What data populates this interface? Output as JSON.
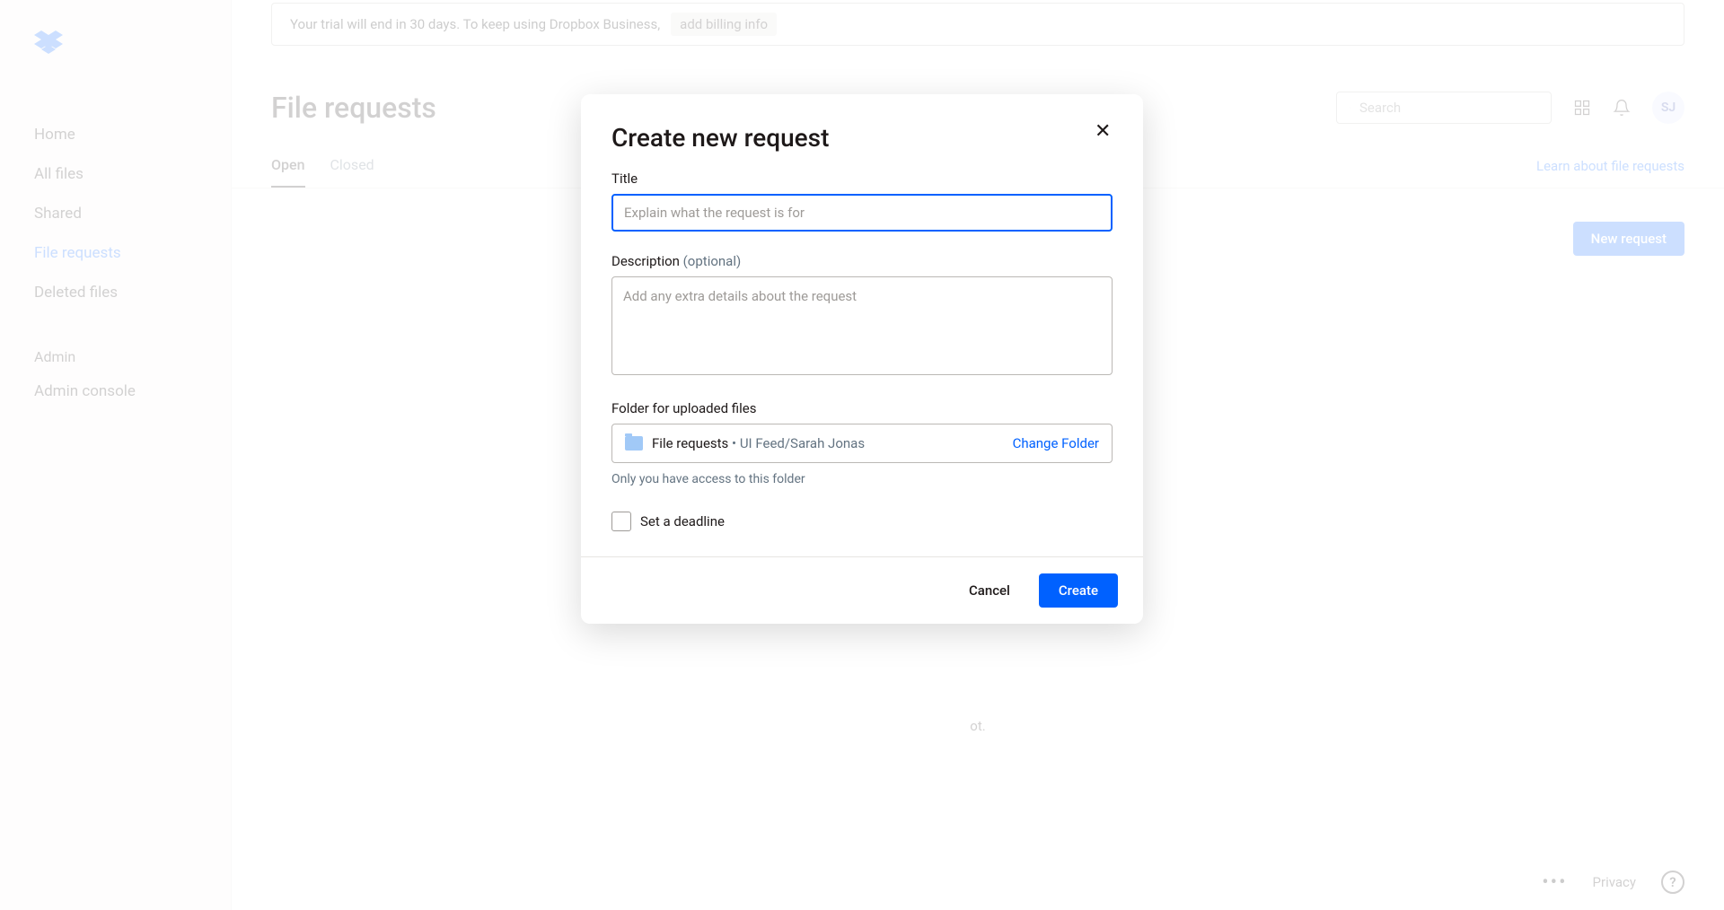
{
  "banner": {
    "text": "Your trial will end in 30 days. To keep using Dropbox Business,",
    "link": "add billing info"
  },
  "sidebar": {
    "items": [
      {
        "label": "Home"
      },
      {
        "label": "All files"
      },
      {
        "label": "Shared"
      },
      {
        "label": "File requests"
      },
      {
        "label": "Deleted files"
      }
    ],
    "admin_header": "Admin",
    "admin_items": [
      {
        "label": "Admin console"
      }
    ]
  },
  "header": {
    "title": "File requests",
    "search_placeholder": "Search",
    "avatar_initials": "SJ"
  },
  "tabs": {
    "items": [
      {
        "label": "Open"
      },
      {
        "label": "Closed"
      }
    ],
    "learn_link": "Learn about file requests"
  },
  "new_request_button": "New request",
  "body_hint_suffix": "ot.",
  "footer": {
    "privacy": "Privacy"
  },
  "modal": {
    "title": "Create new request",
    "title_label": "Title",
    "title_placeholder": "Explain what the request is for",
    "description_label": "Description",
    "description_optional": "(optional)",
    "description_placeholder": "Add any extra details about the request",
    "folder_label": "Folder for uploaded files",
    "folder_name": "File requests",
    "folder_path_separator": " • ",
    "folder_path_rest": "UI Feed/Sarah Jonas",
    "change_folder": "Change Folder",
    "folder_hint": "Only you have access to this folder",
    "deadline_label": "Set a deadline",
    "cancel": "Cancel",
    "create": "Create"
  }
}
